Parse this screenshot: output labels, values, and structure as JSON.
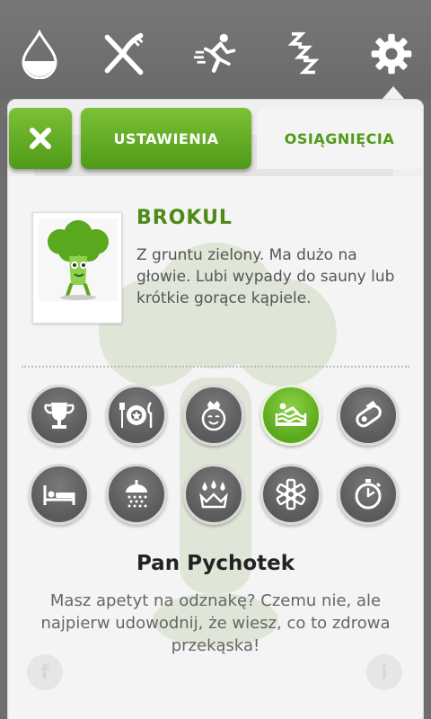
{
  "topbar": {
    "icons": [
      "water-drop-icon",
      "fork-knife-icon",
      "running-icon",
      "sleep-icon",
      "gear-icon"
    ],
    "active": "gear-icon"
  },
  "tabs": {
    "close_icon": "close-icon",
    "settings_label": "USTAWIENIA",
    "achievements_label": "OSIĄGNIĘCIA",
    "active": "achievements"
  },
  "vegetable": {
    "name": "BROKUL",
    "description": "Z gruntu zielony. Ma dużo na głowie. Lubi wypady do sauny lub krótkie gorące kąpiele."
  },
  "badges": [
    {
      "icon": "trophy-icon",
      "active": false
    },
    {
      "icon": "plate-cutlery-icon",
      "active": false
    },
    {
      "icon": "crowned-face-icon",
      "active": false
    },
    {
      "icon": "bath-icon",
      "active": true
    },
    {
      "icon": "whistle-icon",
      "active": false
    },
    {
      "icon": "bed-icon",
      "active": false
    },
    {
      "icon": "shower-icon",
      "active": false
    },
    {
      "icon": "drops-crown-icon",
      "active": false
    },
    {
      "icon": "medical-star-icon",
      "active": false
    },
    {
      "icon": "stopwatch-icon",
      "active": false
    }
  ],
  "selected_badge": {
    "title": "Pan Pychotek",
    "description": "Masz apetyt na odznakę? Czemu nie, ale najpierw udowodnij, że wiesz, co to zdrowa przekąska!"
  },
  "colors": {
    "accent_green": "#5aa81d",
    "title_green": "#4f8a17",
    "background": "#6e6e6e"
  }
}
